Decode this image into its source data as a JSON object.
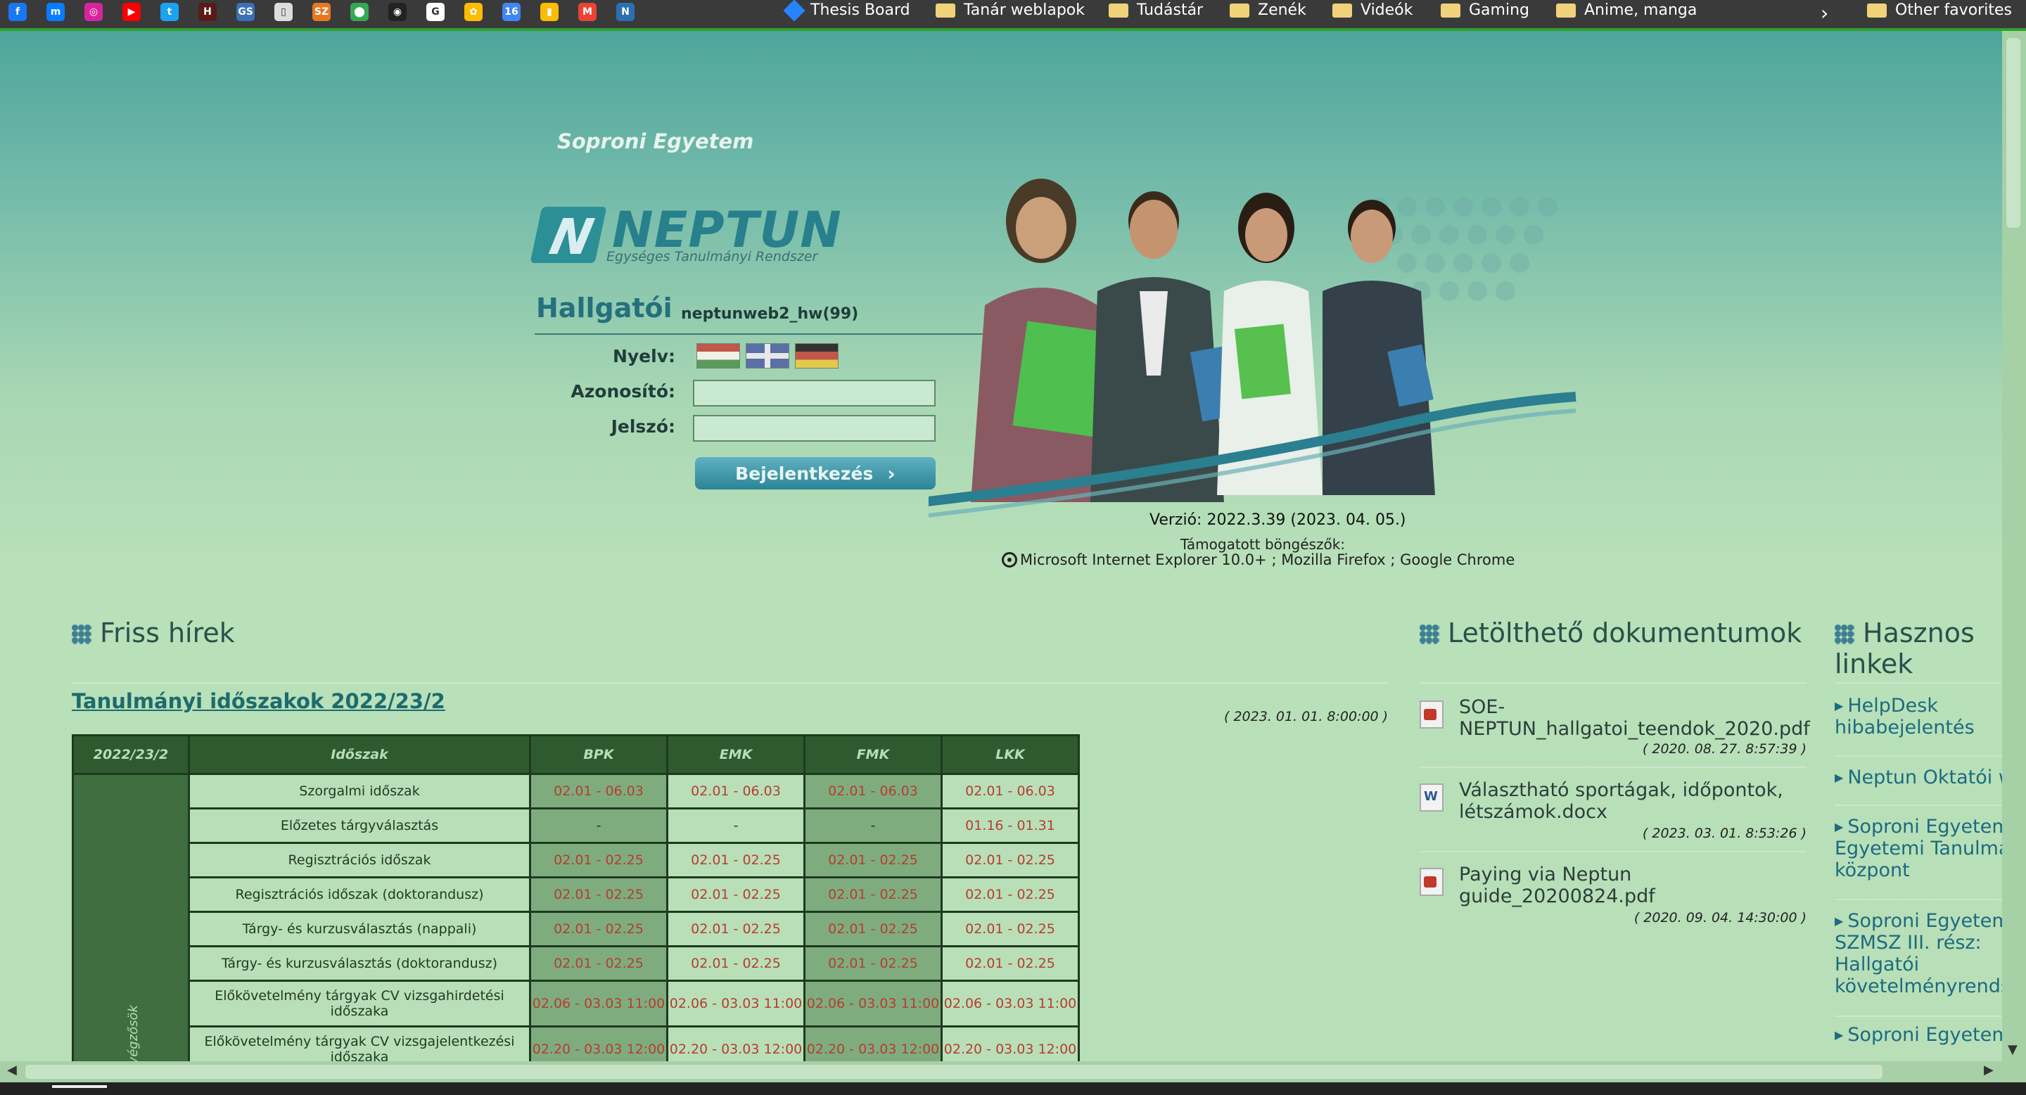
{
  "bookmarks_bar": {
    "icons": [
      {
        "name": "facebook-icon",
        "color": "#1877f2",
        "glyph": "f"
      },
      {
        "name": "messenger-icon",
        "color": "#0a7cff",
        "glyph": "m"
      },
      {
        "name": "instagram-icon",
        "color": "#d6249f",
        "glyph": "◎"
      },
      {
        "name": "youtube-icon",
        "color": "#ff0000",
        "glyph": "▶"
      },
      {
        "name": "twitter-icon",
        "color": "#1da1f2",
        "glyph": "t"
      },
      {
        "name": "letter-icon",
        "color": "#5a1a1a",
        "glyph": "H"
      },
      {
        "name": "gs-icon",
        "color": "#3b6fb6",
        "glyph": "GS"
      },
      {
        "name": "document-icon",
        "color": "#dddddd",
        "glyph": "▯"
      },
      {
        "name": "sz-icon",
        "color": "#e87722",
        "glyph": "SZ"
      },
      {
        "name": "maps-icon",
        "color": "#34a853",
        "glyph": "⬤"
      },
      {
        "name": "github-icon",
        "color": "#222222",
        "glyph": "◉"
      },
      {
        "name": "google-icon",
        "color": "#ffffff",
        "glyph": "G"
      },
      {
        "name": "photos-icon",
        "color": "#fbbc04",
        "glyph": "✿"
      },
      {
        "name": "calendar-icon",
        "color": "#4285f4",
        "glyph": "16"
      },
      {
        "name": "keep-icon",
        "color": "#fbbc04",
        "glyph": "▮"
      },
      {
        "name": "gmail-icon",
        "color": "#ea4335",
        "glyph": "M"
      },
      {
        "name": "neptun-icon",
        "color": "#2c6fb0",
        "glyph": "N"
      }
    ],
    "items": [
      {
        "label": "Thesis Board"
      },
      {
        "label": "Tanár weblapok"
      },
      {
        "label": "Tudástár"
      },
      {
        "label": "Zenék"
      },
      {
        "label": "Videók"
      },
      {
        "label": "Gaming"
      },
      {
        "label": "Anime, manga"
      }
    ],
    "overflow_chevron": "›",
    "other_favorites": "Other favorites"
  },
  "header": {
    "university": "Soproni Egyetem",
    "logo_text": "NEPTUN",
    "logo_mark": "N",
    "logo_subtitle": "Egységes Tanulmányi Rendszer"
  },
  "login": {
    "title": "Hallgatói",
    "server": "neptunweb2_hw(99)",
    "language_label": "Nyelv:",
    "username_label": "Azonosító:",
    "password_label": "Jelszó:",
    "username_value": "",
    "password_value": "",
    "login_button": "Bejelentkezés",
    "login_arrow": "›"
  },
  "version": {
    "text": "Verzió: 2022.3.39 (2023. 04. 05.)",
    "supported_label": "Támogatott böngészők:",
    "browsers": "Microsoft Internet Explorer 10.0+ ; Mozilla Firefox ; Google Chrome"
  },
  "news": {
    "title": "Friss hírek",
    "item_title": "Tanulmányi időszakok 2022/23/2",
    "item_date": "( 2023. 01. 01. 8:00:00 )",
    "table": {
      "headers": [
        "2022/23/2",
        "Időszak",
        "BPK",
        "EMK",
        "FMK",
        "LKK"
      ],
      "side_label": "végzősök",
      "rows": [
        {
          "name": "Szorgalmi időszak",
          "values": [
            "02.01 - 06.03",
            "02.01 - 06.03",
            "02.01 - 06.03",
            "02.01 - 06.03"
          ]
        },
        {
          "name": "Előzetes tárgyválasztás",
          "values": [
            "-",
            "-",
            "-",
            "01.16 - 01.31"
          ]
        },
        {
          "name": "Regisztrációs időszak",
          "values": [
            "02.01 - 02.25",
            "02.01 - 02.25",
            "02.01 - 02.25",
            "02.01 - 02.25"
          ]
        },
        {
          "name": "Regisztrációs időszak (doktorandusz)",
          "values": [
            "02.01 - 02.25",
            "02.01 - 02.25",
            "02.01 - 02.25",
            "02.01 - 02.25"
          ]
        },
        {
          "name": "Tárgy- és kurzusválasztás (nappali)",
          "values": [
            "02.01 - 02.25",
            "02.01 - 02.25",
            "02.01 - 02.25",
            "02.01 - 02.25"
          ]
        },
        {
          "name": "Tárgy- és kurzusválasztás (doktorandusz)",
          "values": [
            "02.01 - 02.25",
            "02.01 - 02.25",
            "02.01 - 02.25",
            "02.01 - 02.25"
          ]
        },
        {
          "name": "Előkövetelmény tárgyak CV vizsgahirdetési időszaka",
          "values": [
            "02.06 - 03.03 11:00",
            "02.06 - 03.03 11:00",
            "02.06 - 03.03 11:00",
            "02.06 - 03.03 11:00"
          ]
        },
        {
          "name": "Előkövetelmény tárgyak CV vizsgajelentkezési időszaka",
          "values": [
            "02.20 - 03.03 12:00",
            "02.20 - 03.03 12:00",
            "02.20 - 03.03 12:00",
            "02.20 - 03.03 12:00"
          ]
        }
      ]
    }
  },
  "documents": {
    "title": "Letölthető dokumentumok",
    "items": [
      {
        "name": "SOE-NEPTUN_hallgatoi_teendok_2020.pdf",
        "name_l1": "SOE-",
        "name_l2": "NEPTUN_hallgatoi_teendok_2020.pdf",
        "date": "( 2020. 08. 27. 8:57:39 )",
        "type": "pdf"
      },
      {
        "name": "Választható sportágak, időpontok, létszámok.docx",
        "name_l1": "Választható sportágak, időpontok,",
        "name_l2": "létszámok.docx",
        "date": "( 2023. 03. 01. 8:53:26 )",
        "type": "word"
      },
      {
        "name": "Paying via Neptun guide_20200824.pdf",
        "name_l1": "Paying via Neptun",
        "name_l2": "guide_20200824.pdf",
        "date": "( 2020. 09. 04. 14:30:00 )",
        "type": "pdf"
      }
    ]
  },
  "links": {
    "title_l1": "Hasznos",
    "title_l2": "linkek",
    "items": [
      {
        "l1": "HelpDesk",
        "l2": "hibabejelentés"
      },
      {
        "l1": "Neptun Oktatói w"
      },
      {
        "l1": "Soproni Egyetem",
        "l2": "Egyetemi Tanulmá",
        "l3": "központ"
      },
      {
        "l1": "Soproni Egyetem",
        "l2": "SZMSZ III. rész:",
        "l3": "Hallgatói",
        "l4": "követelményrends"
      },
      {
        "l1": "Soproni Egyetem"
      }
    ]
  },
  "colors": {
    "accent": "#27808c",
    "table_header": "#2f5a30",
    "date_text": "#b53e2e"
  }
}
